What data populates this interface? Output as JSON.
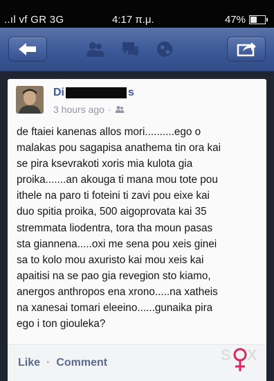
{
  "status_bar": {
    "carrier": "..ıl vf GR 3G",
    "time": "4:17 π.μ.",
    "battery": "47%",
    "battery_level": 0.47
  },
  "navbar": {
    "back_icon": "back-arrow-icon",
    "center_icons": [
      "friend-requests-icon",
      "messages-icon",
      "notifications-globe-icon"
    ],
    "share_icon": "share-icon"
  },
  "post": {
    "author_visible_start": "Di",
    "author_visible_end": "s",
    "timestamp": "3 hours ago",
    "meta_separator": "·",
    "audience_icon": "friends-icon",
    "text": "de ftaiei kanenas allos mori..........ego o\nmalakas pou sagapisa anathema tin ora kai\nse pira ksevrakoti xoris mia kulota gia\nproika.......an akouga ti mana mou tote pou\nithele na paro ti foteini ti zavi pou eixe kai\nduo spitia proika, 500 aigoprovata kai 35\nstremmata liodentra, tora tha moun pasas\nsta giannena.....oxi me sena pou xeis ginei\nsa to kolo mou axuristo kai mou xeis kai\napaitisi na se pao gia revegion sto kiamo,\nanergos anthropos ena xrono.....na xatheis\nna xanesai tomari eleeino......gunaika pira\nego i ton giouleka?"
  },
  "actions": {
    "like": "Like",
    "separator": "·",
    "comment": "Comment"
  },
  "colors": {
    "facebook_blue": "#3b5998",
    "status_bar": "#050505",
    "watermark_pink": "#e0245e"
  }
}
